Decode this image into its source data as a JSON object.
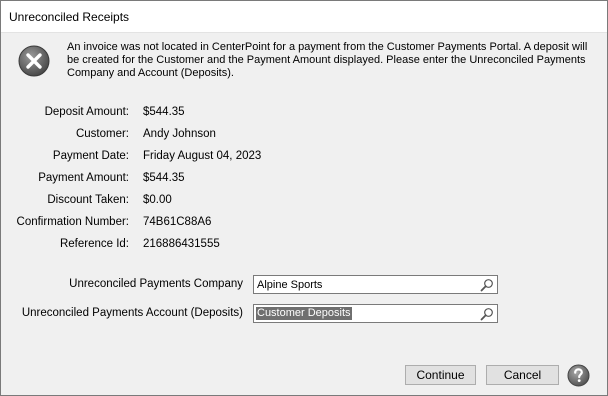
{
  "dialog": {
    "title": "Unreconciled Receipts",
    "message": "An invoice was not located in CenterPoint for a payment from the Customer Payments Portal. A deposit will be created for the Customer and the Payment Amount displayed. Please enter the Unreconciled Payments Company and Account (Deposits)."
  },
  "details": [
    {
      "label": "Deposit Amount:",
      "value": "$544.35"
    },
    {
      "label": "Customer:",
      "value": "Andy Johnson"
    },
    {
      "label": "Payment Date:",
      "value": "Friday August 04, 2023"
    },
    {
      "label": "Payment Amount:",
      "value": "$544.35"
    },
    {
      "label": "Discount Taken:",
      "value": "$0.00"
    },
    {
      "label": "Confirmation Number:",
      "value": "74B61C88A6"
    },
    {
      "label": "Reference Id:",
      "value": "216886431555"
    }
  ],
  "fields": {
    "company": {
      "label": "Unreconciled Payments Company",
      "value": "Alpine Sports"
    },
    "account": {
      "label": "Unreconciled Payments Account (Deposits)",
      "value": "Customer Deposits"
    }
  },
  "buttons": {
    "continue": "Continue",
    "cancel": "Cancel"
  },
  "icons": {
    "error": "error-x-icon",
    "search": "magnifier-icon",
    "help": "question-icon"
  }
}
